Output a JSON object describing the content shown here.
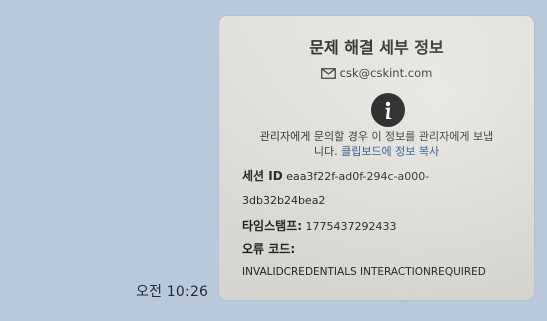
{
  "chat": {
    "time": "오전 10:26"
  },
  "photo": {
    "title": "문제 해결 세부 정보",
    "email": "csk@cskint.com",
    "message_line1": "관리자에게 문의할 경우 이 정보를 관리자에게 보냅",
    "message_line2_prefix": "니다.",
    "copy_link": "클립보드에 정보 복사",
    "session_label": "세션 ID",
    "session_value_part1": "eaa3f22f-ad0f-294c-a000-",
    "session_value_part2": "3db32b24bea2",
    "timestamp_label": "타임스탬프:",
    "timestamp_value": "1775437292433",
    "error_label": "오류 코드:",
    "error_value": "INVALIDCREDENTIALS INTERACTIONREQUIRED"
  },
  "icons": {
    "mail": "envelope-icon",
    "logo": "logo-icon"
  }
}
